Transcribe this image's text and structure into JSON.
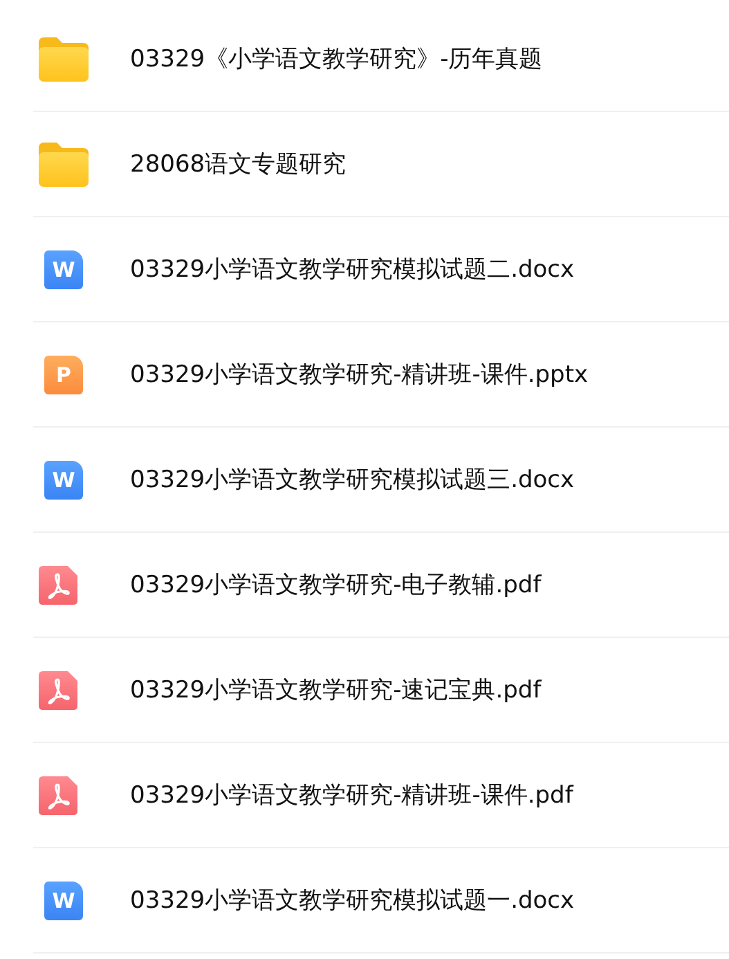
{
  "files": [
    {
      "kind": "folder",
      "name": "03329《小学语文教学研究》-历年真题"
    },
    {
      "kind": "folder",
      "name": "28068语文专题研究"
    },
    {
      "kind": "word",
      "letter": "W",
      "name": "03329小学语文教学研究模拟试题二.docx"
    },
    {
      "kind": "ppt",
      "letter": "P",
      "name": "03329小学语文教学研究-精讲班-课件.pptx"
    },
    {
      "kind": "word",
      "letter": "W",
      "name": "03329小学语文教学研究模拟试题三.docx"
    },
    {
      "kind": "pdf",
      "name": "03329小学语文教学研究-电子教辅.pdf"
    },
    {
      "kind": "pdf",
      "name": "03329小学语文教学研究-速记宝典.pdf"
    },
    {
      "kind": "pdf",
      "name": "03329小学语文教学研究-精讲班-课件.pdf"
    },
    {
      "kind": "word",
      "letter": "W",
      "name": "03329小学语文教学研究模拟试题一.docx"
    }
  ]
}
